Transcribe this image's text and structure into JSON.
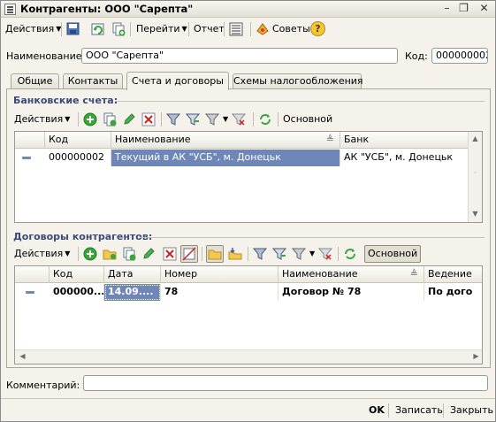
{
  "window": {
    "title": "Контрагенты: ООО \"Сарепта\"",
    "controls": {
      "minimize": "–",
      "restore": "❐",
      "close": "✕"
    }
  },
  "toolbar": {
    "actions_label": "Действия",
    "goto_label": "Перейти",
    "report_label": "Отчет",
    "tips_label": "Советы",
    "help_label": "?"
  },
  "form": {
    "name_label": "Наименование:",
    "name_value": "ООО \"Сарепта\"",
    "code_label": "Код:",
    "code_value": "000000002"
  },
  "tabs": [
    {
      "label": "Общие"
    },
    {
      "label": "Контакты"
    },
    {
      "label": "Счета и договоры",
      "active": true
    },
    {
      "label": "Схемы налогообложения"
    }
  ],
  "bank_accounts": {
    "title": "Банковские счета:",
    "actions_label": "Действия",
    "main_label": "Основной",
    "columns": [
      "Код",
      "Наименование",
      "Банк"
    ],
    "rows": [
      {
        "code": "000000002",
        "name": "Текущий в АК \"УСБ\", м. Донецьк",
        "bank": "АК \"УСБ\", м. Донецьк"
      }
    ]
  },
  "contracts": {
    "title": "Договоры контрагентов:",
    "actions_label": "Действия",
    "main_label": "Основной",
    "columns": [
      "Код",
      "Дата",
      "Номер",
      "Наименование",
      "Ведение"
    ],
    "rows": [
      {
        "code": "000000...",
        "date": "14.09....",
        "number": "78",
        "name": "Договор № 78",
        "mode": "По дого"
      }
    ]
  },
  "comment": {
    "label": "Комментарий:",
    "value": ""
  },
  "buttons": {
    "ok": "OK",
    "save": "Записать",
    "close": "Закрыть"
  },
  "colors": {
    "selection": "#6f86b8",
    "group_title": "#3b4a78",
    "green": "#3aa53a",
    "red": "#d02020"
  }
}
